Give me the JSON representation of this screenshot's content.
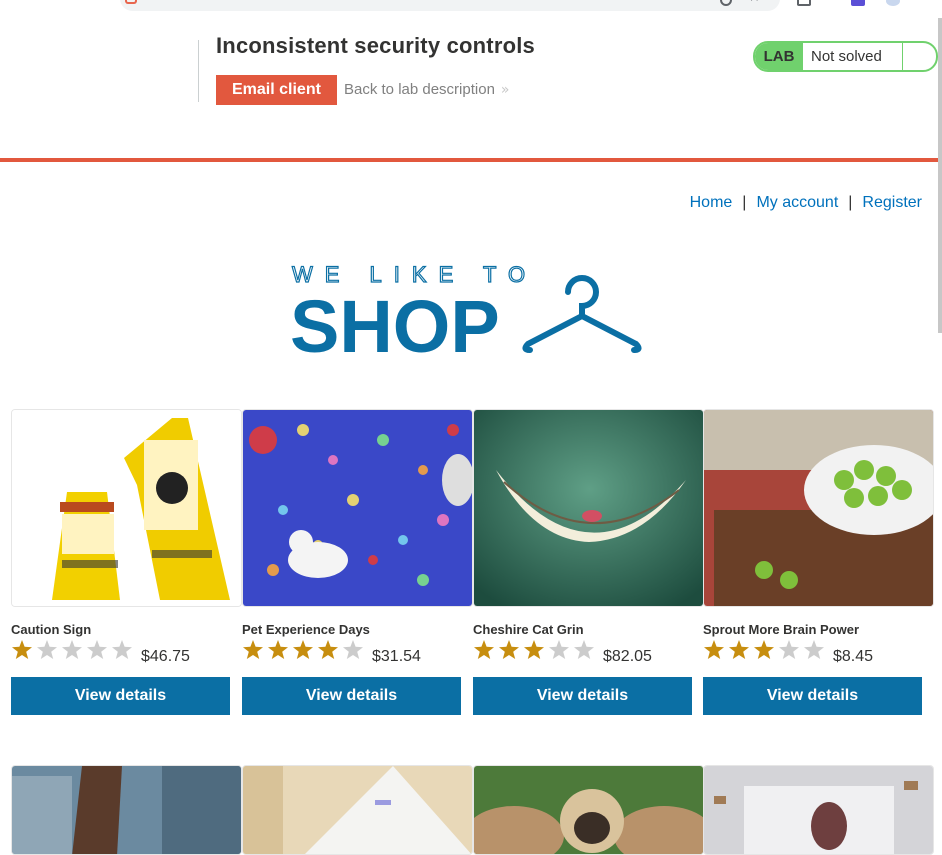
{
  "colors": {
    "accent_orange": "#e2583e",
    "lab_green": "#70d16d",
    "button_blue": "#0b6fa4",
    "link_blue": "#0071bc",
    "logo_blue": "#0b6fa4",
    "star_gold": "#c78e0f",
    "star_grey": "#cccccc"
  },
  "lab": {
    "title": "Inconsistent security controls",
    "email_client_label": "Email client",
    "back_link_label": "Back to lab description",
    "status_badge": "LAB",
    "status_text": "Not solved"
  },
  "nav": {
    "home": "Home",
    "my_account": "My account",
    "register": "Register",
    "separator": "|"
  },
  "logo": {
    "top_text": "WE LIKE TO",
    "main_text": "SHOP"
  },
  "products": [
    {
      "name": "Caution Sign",
      "price": "$46.75",
      "rating": 1,
      "button": "View details",
      "image_icon": "caution-sign-image"
    },
    {
      "name": "Pet Experience Days",
      "price": "$31.54",
      "rating": 4,
      "button": "View details",
      "image_icon": "pet-experience-image"
    },
    {
      "name": "Cheshire Cat Grin",
      "price": "$82.05",
      "rating": 3,
      "button": "View details",
      "image_icon": "cheshire-grin-image"
    },
    {
      "name": "Sprout More Brain Power",
      "price": "$8.45",
      "rating": 3,
      "button": "View details",
      "image_icon": "sprouts-image"
    }
  ],
  "products_row2_icons": [
    "city-boot-image",
    "paper-plane-image",
    "pug-owl-image",
    "flying-books-image"
  ]
}
